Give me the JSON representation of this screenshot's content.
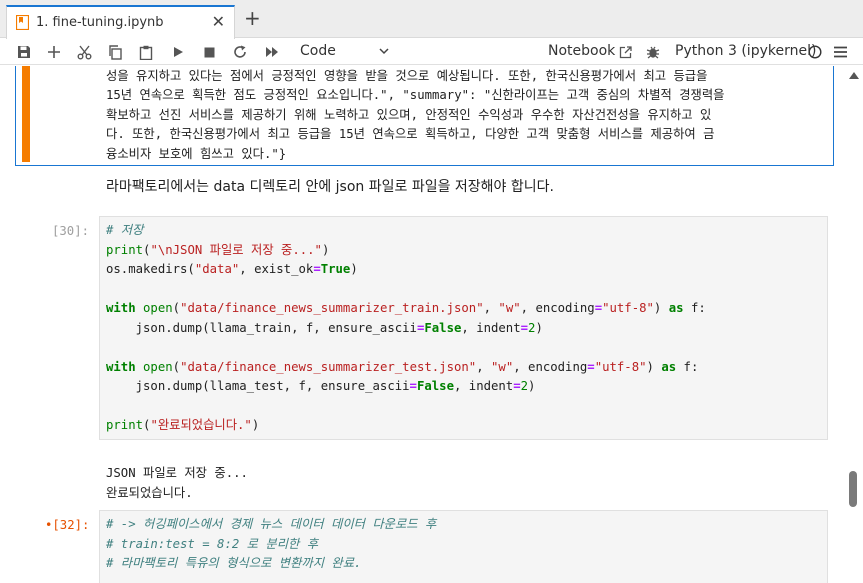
{
  "tab": {
    "title": "1. fine-tuning.ipynb",
    "close_glyph": "✕",
    "add_glyph": "+"
  },
  "toolbar": {
    "cell_type": "Code",
    "notebook_label": "Notebook",
    "kernel_label": "Python 3 (ipykernel)",
    "icons": [
      "save-icon",
      "add-cell-icon",
      "cut-icon",
      "copy-icon",
      "paste-icon",
      "run-icon",
      "stop-icon",
      "restart-icon",
      "run-all-icon",
      "chevron-down-icon",
      "open-external-icon",
      "debugger-icon",
      "kernel-idle-icon",
      "menu-icon"
    ]
  },
  "output_cell": {
    "lines": [
      "성을 유지하고 있다는 점에서 긍정적인 영향을 받을 것으로 예상됩니다. 또한, 한국신용평가에서 최고 등급을",
      "15년 연속으로 획득한 점도 긍정적인 요소입니다.\", \"summary\": \"신한라이프는 고객 중심의 차별적 경쟁력을",
      "확보하고 선진 서비스를 제공하기 위해 노력하고 있으며, 안정적인 수익성과 우수한 자산건전성을 유지하고 있",
      "다. 또한, 한국신용평가에서 최고 등급을 15년 연속으로 획득하고, 다양한 고객 맞춤형 서비스를 제공하여 금",
      "융소비자 보호에 힘쓰고 있다.\"}"
    ]
  },
  "markdown_cell": {
    "text": "라마팩토리에서는 data 디렉토리 안에 json 파일로 파일을 저장해야 합니다."
  },
  "cell_30": {
    "prompt": "[30]:",
    "output_lines": [
      "JSON 파일로 저장 중...",
      "완료되었습니다."
    ]
  },
  "cell_32": {
    "prompt": "•[32]:"
  },
  "colors": {
    "accent_blue": "#1976d2",
    "active_orange": "#f57c00",
    "comment": "#408080",
    "keyword": "#008000",
    "string": "#ba2121"
  }
}
